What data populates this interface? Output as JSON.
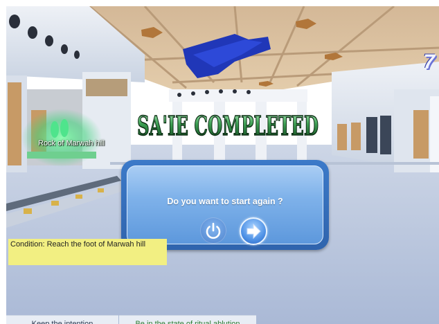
{
  "hud": {
    "counter": "7"
  },
  "scene": {
    "location_label": "Rock of Marwah hill"
  },
  "banner": {
    "title": "SA'IE COMPLETED"
  },
  "dialog": {
    "question": "Do you want to start again ?",
    "buttons": [
      {
        "icon": "power-icon",
        "action": "quit"
      },
      {
        "icon": "arrow-right-icon",
        "action": "restart"
      }
    ]
  },
  "condition": {
    "text": "Condition: Reach the foot of Marwah hill"
  },
  "tabs": [
    {
      "label": "Keep the intention"
    },
    {
      "label": "Be in the state of ritual ablution"
    }
  ],
  "colors": {
    "title_green": "#2f8a3c",
    "dialog_blue": "#3c7ac9",
    "condition_bg": "#f2ef82",
    "tab_green_text": "#2e7d32"
  }
}
